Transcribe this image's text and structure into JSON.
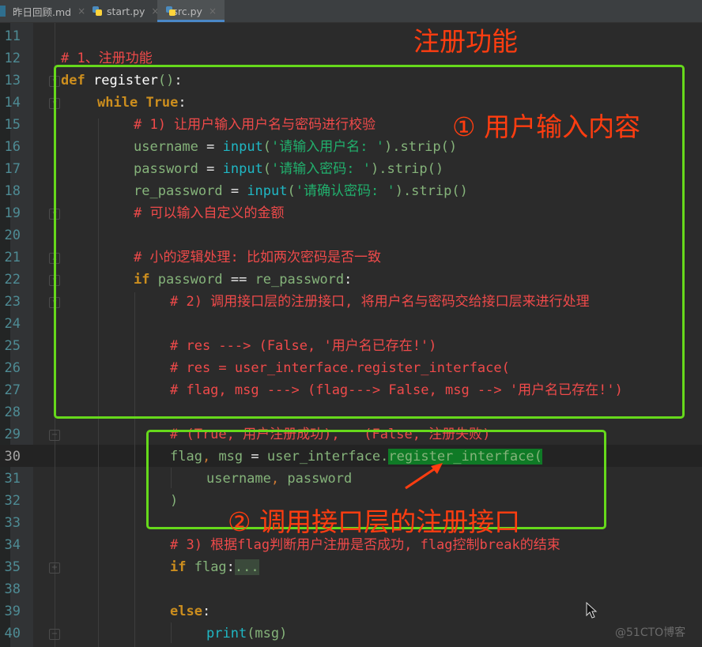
{
  "tabs": [
    {
      "label": "昨日回顾.md",
      "icon": "markdown-icon",
      "active": false
    },
    {
      "label": "start.py",
      "icon": "python-icon",
      "active": false
    },
    {
      "label": "src.py",
      "icon": "python-icon",
      "active": true
    }
  ],
  "tab_close_glyph": "×",
  "line_numbers": [
    "11",
    "12",
    "13",
    "14",
    "15",
    "16",
    "17",
    "18",
    "19",
    "20",
    "21",
    "22",
    "23",
    "24",
    "25",
    "26",
    "27",
    "28",
    "29",
    "30",
    "31",
    "32",
    "33",
    "34",
    "35",
    "38",
    "39",
    "40"
  ],
  "code": {
    "l12": "# 1、注册功能",
    "l13_kw": "def",
    "l13_fn": "register",
    "l13_par": "()",
    "l13_colon": ":",
    "l14_kw1": "while",
    "l14_kw2": "True",
    "l14_colon": ":",
    "l15": "# 1) 让用户输入用户名与密码进行校验",
    "l16_var": "username",
    "l16_eq": " = ",
    "l16_bi": "input",
    "l16_p1": "(",
    "l16_str": "'请输入用户名: '",
    "l16_rest": ").strip()",
    "l17_var": "password",
    "l17_eq": " = ",
    "l17_bi": "input",
    "l17_p1": "(",
    "l17_str": "'请输入密码: '",
    "l17_rest": ").strip()",
    "l18_var": "re_password",
    "l18_eq": " = ",
    "l18_bi": "input",
    "l18_p1": "(",
    "l18_str": "'请确认密码: '",
    "l18_rest": ").strip()",
    "l19": "# 可以输入自定义的金额",
    "l21": "# 小的逻辑处理: 比如两次密码是否一致",
    "l22_kw": "if",
    "l22_a": " password ",
    "l22_eq": "==",
    "l22_b": " re_password",
    "l22_colon": ":",
    "l23": "# 2) 调用接口层的注册接口, 将用户名与密码交给接口层来进行处理",
    "l25": "# res ---> (False, '用户名已存在!')",
    "l26": "# res = user_interface.register_interface(",
    "l27": "# flag, msg ---> (flag---> False, msg --> '用户名已存在!')",
    "l29": "# (True, 用户注册成功),   (False, 注册失败)",
    "l30_a": "flag",
    "l30_comma": ",",
    "l30_b": " msg ",
    "l30_eq": "=",
    "l30_c": " user_interface.",
    "l30_hl": "register_interface(",
    "l31_a": "username",
    "l31_comma": ",",
    "l31_b": " password",
    "l32": ")",
    "l34": "# 3) 根据flag判断用户注册是否成功, flag控制break的结束",
    "l35_kw": "if",
    "l35_var": " flag",
    "l35_colon": ":",
    "l35_fold": "...",
    "l39_kw": "else",
    "l39_colon": ":",
    "l40_bi": "print",
    "l40_rest": "(msg)"
  },
  "annotations": {
    "title": "注册功能",
    "step1": "① 用户输入内容",
    "step2": "② 调用接口层的注册接口"
  },
  "watermark": "@51CTO博客",
  "colors": {
    "highlight_box": "#66d91b",
    "annotation": "#ff3d10",
    "keyword": "#cc8e1e",
    "comment": "#ef4a4a",
    "string": "#21b06d"
  }
}
